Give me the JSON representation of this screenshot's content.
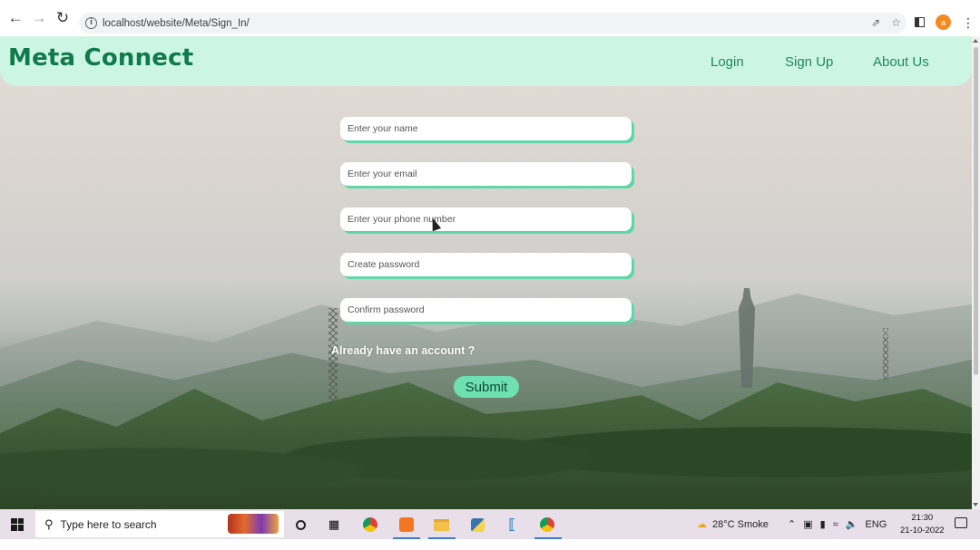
{
  "browser": {
    "url": "localhost/website/Meta/Sign_In/",
    "profile_initial": "a"
  },
  "site": {
    "brand": "Meta Connect",
    "nav": {
      "login": "Login",
      "signup": "Sign Up",
      "about": "About Us"
    }
  },
  "form": {
    "name_placeholder": "Enter your name",
    "email_placeholder": "Enter your email",
    "phone_placeholder": "Enter your phone number",
    "password_placeholder": "Create password",
    "confirm_placeholder": "Confirm password",
    "already_text": "Already have an account ?",
    "submit_label": "Submit"
  },
  "taskbar": {
    "search_placeholder": "Type here to search",
    "weather": "28°C  Smoke",
    "language": "ENG",
    "time": "21:30",
    "date": "21-10-2022"
  },
  "colors": {
    "nav_bg": "#cdf5e3",
    "brand": "#0f7a4a",
    "accent": "#5fd6a7",
    "submit_bg": "#6fe0b2"
  }
}
